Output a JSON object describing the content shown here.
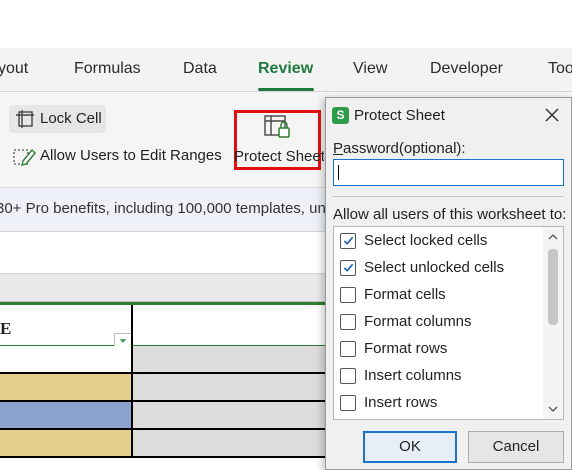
{
  "ribbon_tabs": {
    "layout": "yout",
    "formulas": "Formulas",
    "data": "Data",
    "review": "Review",
    "view": "View",
    "developer": "Developer",
    "tools": "Too"
  },
  "ribbon": {
    "lock_cell": "Lock Cell",
    "allow_ranges": "Allow Users to Edit Ranges",
    "protect_sheet": "Protect Sheet"
  },
  "banner": {
    "text": "30+ Pro benefits, including 100,000 templates, unl"
  },
  "sheet": {
    "header_cell": "E",
    "row_colors": [
      "#e6cf8c",
      "#8da3cf",
      "#e6cf8c"
    ]
  },
  "dialog": {
    "app_icon": "S",
    "title": "Protect Sheet",
    "close": "✕",
    "password_label_underlined": "P",
    "password_label_rest": "assword(optional):",
    "password_value": "",
    "allow_label": "Allow all users of this worksheet to:",
    "options": [
      {
        "label": "Select locked cells",
        "checked": true
      },
      {
        "label": "Select unlocked cells",
        "checked": true
      },
      {
        "label": "Format cells",
        "checked": false
      },
      {
        "label": "Format columns",
        "checked": false
      },
      {
        "label": "Format rows",
        "checked": false
      },
      {
        "label": "Insert columns",
        "checked": false
      },
      {
        "label": "Insert rows",
        "checked": false
      }
    ],
    "ok": "OK",
    "cancel": "Cancel"
  },
  "colors": {
    "accent": "#1f7a3f",
    "highlight_border": "#e01010",
    "focus": "#1a73c8"
  }
}
